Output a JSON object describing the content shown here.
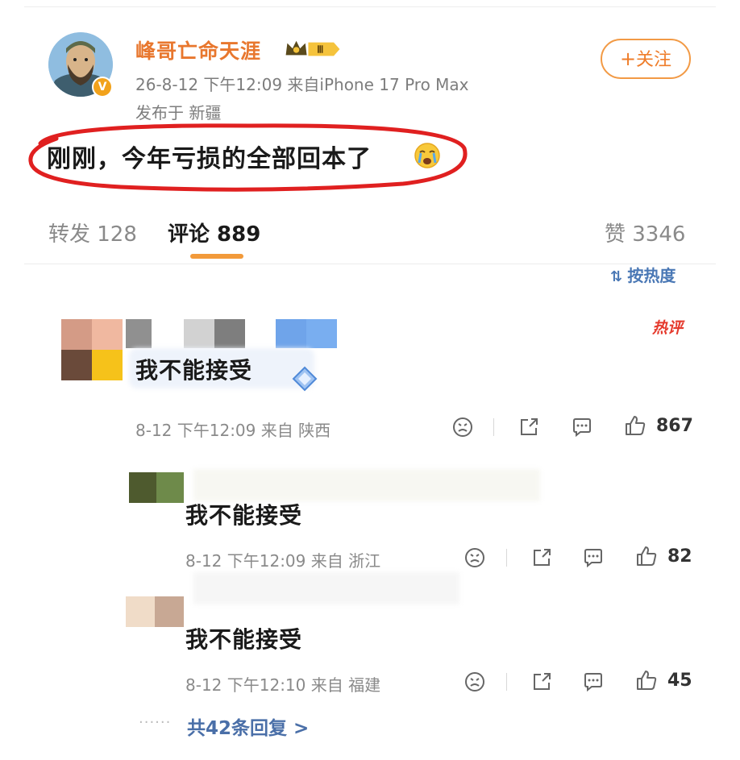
{
  "post": {
    "username": "峰哥亡命天涯",
    "vip_level": "Ⅲ",
    "meta": "26-8-12 下午12:09  来自iPhone 17 Pro Max",
    "location": "发布于 新疆",
    "follow_label": "关注",
    "text": "刚刚，今年亏损的全部回本了"
  },
  "tabs": {
    "repost": "转发 128",
    "comment": "评论 889",
    "like": "赞 3346"
  },
  "sort_label": "按热度",
  "hot_tag": "热评",
  "comments": [
    {
      "text": "我不能接受",
      "time": "8-12 下午12:09  来自 陕西",
      "likes": "867"
    },
    {
      "text": "我不能接受",
      "time": "8-12 下午12:09  来自 浙江",
      "likes": "82"
    },
    {
      "text": "我不能接受",
      "time": "8-12 下午12:10  来自 福建",
      "likes": "45"
    }
  ],
  "more_replies": "共42条回复 >",
  "colors": {
    "accent": "#ef7d2a",
    "link": "#4a6fa8",
    "highlight": "#e02020"
  }
}
